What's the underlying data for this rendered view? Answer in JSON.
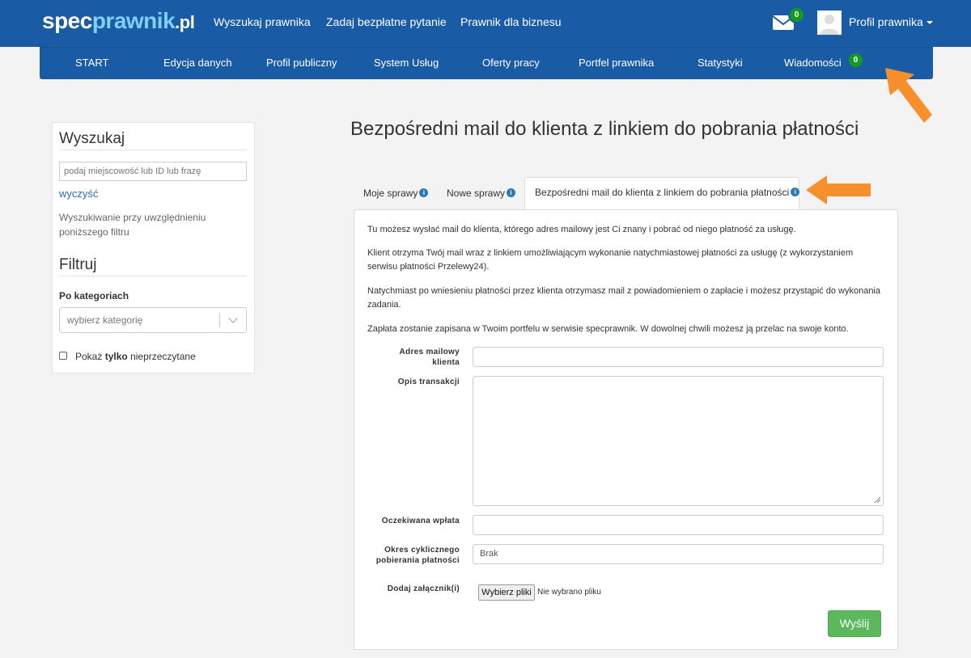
{
  "header": {
    "logo": {
      "part1": "spec",
      "part2": "prawnik",
      "part3": ".pl"
    },
    "nav": [
      "Wyszukaj prawnika",
      "Zadaj bezpłatne pytanie",
      "Prawnik dla biznesu"
    ],
    "mail_badge": "0",
    "profile_label": "Profil prawnika"
  },
  "subnav": {
    "items": [
      "START",
      "Edycja danych",
      "Profil publiczny",
      "System Usług",
      "Oferty pracy",
      "Portfel prawnika",
      "Statystyki",
      "Wiadomości"
    ],
    "messages_badge": "0"
  },
  "sidebar": {
    "search_heading": "Wyszukaj",
    "search_placeholder": "podaj miejscowość lub ID lub frazę",
    "clear_link": "wyczyść",
    "filter_note": "Wyszukiwanie przy uwzględnieniu poniższego filtru",
    "filter_heading": "Filtruj",
    "category_label": "Po kategoriach",
    "category_placeholder": "wybierz kategorię",
    "checkbox_prefix": "Pokaż",
    "checkbox_bold": "tylko",
    "checkbox_suffix": "nieprzeczytane"
  },
  "main": {
    "title": "Bezpośredni mail do klienta z linkiem do pobrania płatności",
    "tabs": [
      {
        "label": "Moje sprawy"
      },
      {
        "label": "Nowe sprawy"
      },
      {
        "label": "Bezpośredni mail do klienta z linkiem do pobrania płatności"
      }
    ],
    "paragraphs": [
      "Tu możesz wysłać mail do klienta, którego adres mailowy jest Ci znany i pobrać od niego płatność za usługę.",
      "Klient otrzyma Twój mail wraz z linkiem umożliwiającym wykonanie natychmiastowej płatności za usługę (z wykorzystaniem serwisu płatności Przelewy24).",
      "Natychmiast po wniesieniu płatności przez klienta otrzymasz mail z powiadomieniem o zapłacie i możesz przystąpić do wykonania zadania.",
      "Zapłata zostanie zapisana w Twoim portfelu w serwisie specprawnik. W dowolnej chwili możesz ją przelac na swoje konto."
    ],
    "form": {
      "email_label": "Adres mailowy klienta",
      "email_value": "",
      "description_label": "Opis transakcji",
      "description_value": "",
      "amount_label": "Oczekiwana wpłata",
      "amount_value": "",
      "cycle_label": "Okres cyklicznego pobierania płatności",
      "cycle_value": "Brak",
      "attachment_label": "Dodaj załącznik(i)",
      "file_button": "Wybierz pliki",
      "file_status": "Nie wybrano pliku",
      "submit_label": "Wyślij"
    }
  },
  "colors": {
    "navbar": "#1a5ba6",
    "accent_arrow": "#f7902c",
    "badge": "#159a20",
    "submit": "#5cb85c",
    "info_icon": "#2a7ab8"
  }
}
